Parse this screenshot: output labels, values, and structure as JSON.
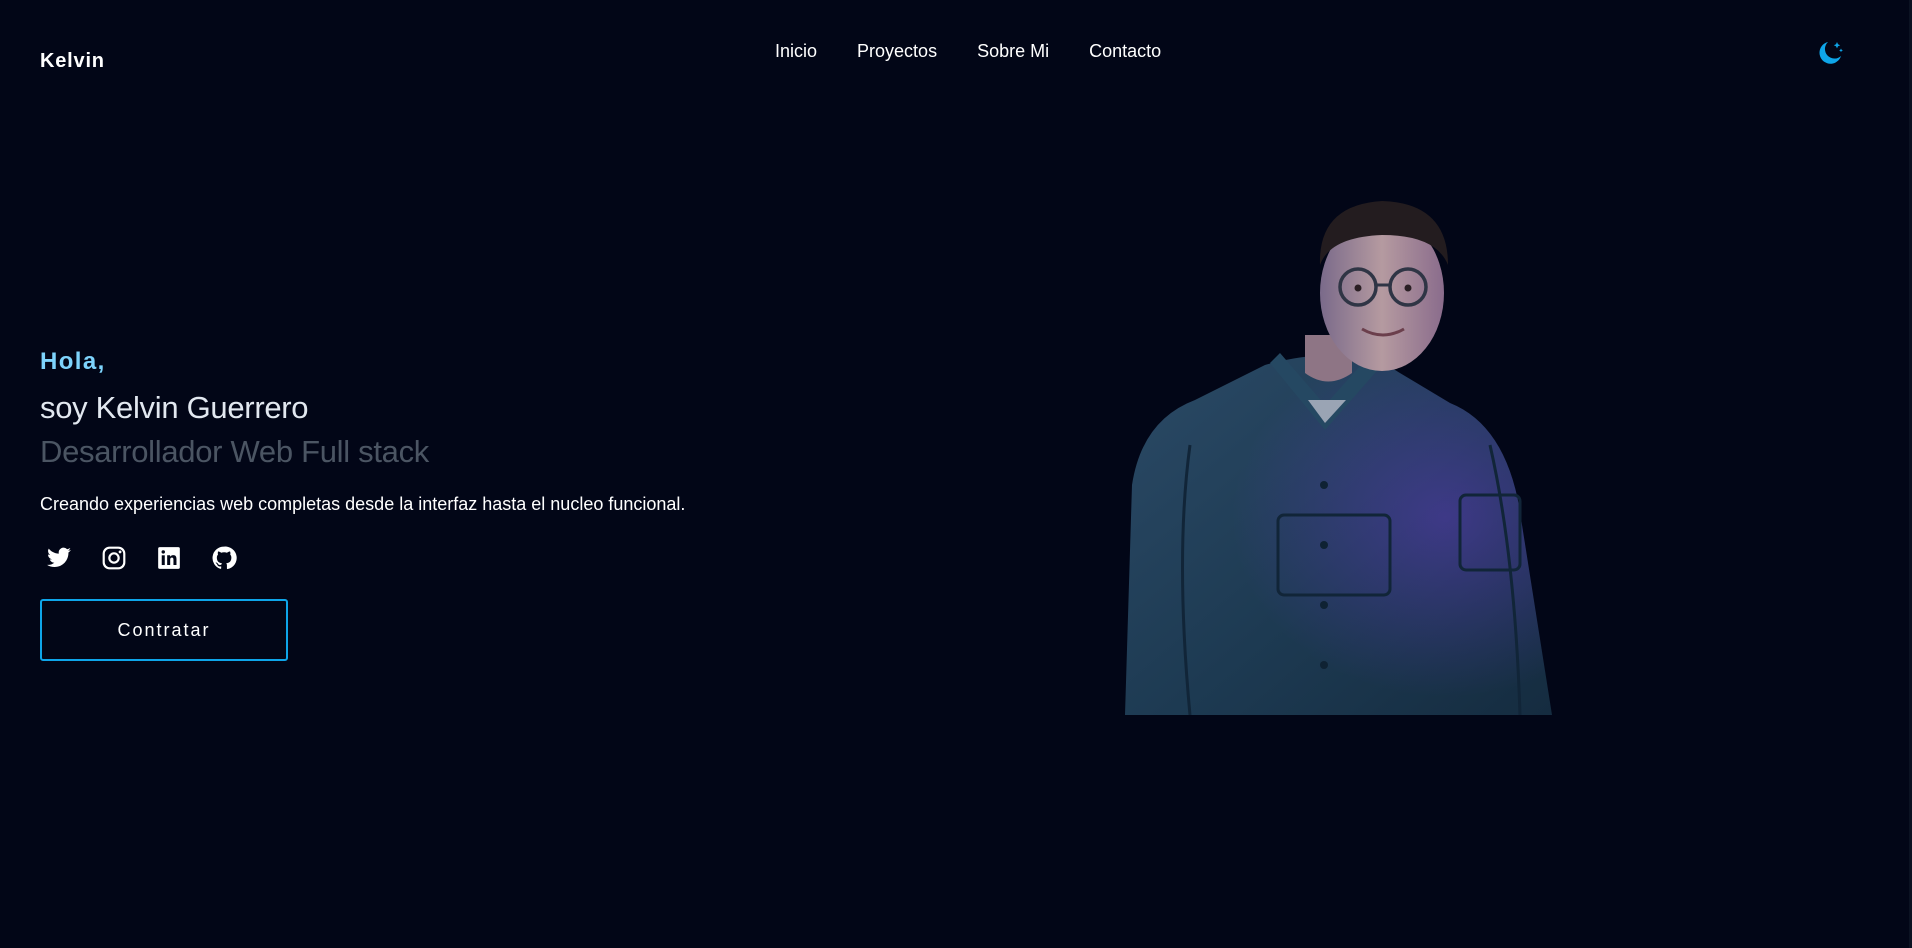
{
  "header": {
    "logo": "Kelvin",
    "nav": [
      "Inicio",
      "Proyectos",
      "Sobre Mi",
      "Contacto"
    ],
    "theme_icon": "moon-stars-icon"
  },
  "hero": {
    "greeting": "Hola,",
    "name": "soy Kelvin Guerrero",
    "role": "Desarrollador Web Full stack",
    "tagline": "Creando experiencias web completas desde la interfaz hasta el nucleo funcional.",
    "socials": [
      "twitter-icon",
      "instagram-icon",
      "linkedin-icon",
      "github-icon"
    ],
    "cta_label": "Contratar",
    "portrait": "person-portrait-photo"
  },
  "colors": {
    "background": "#020617",
    "accent": "#0ea5e9",
    "greeting": "#7dd3fc",
    "role": "#4b5563"
  }
}
